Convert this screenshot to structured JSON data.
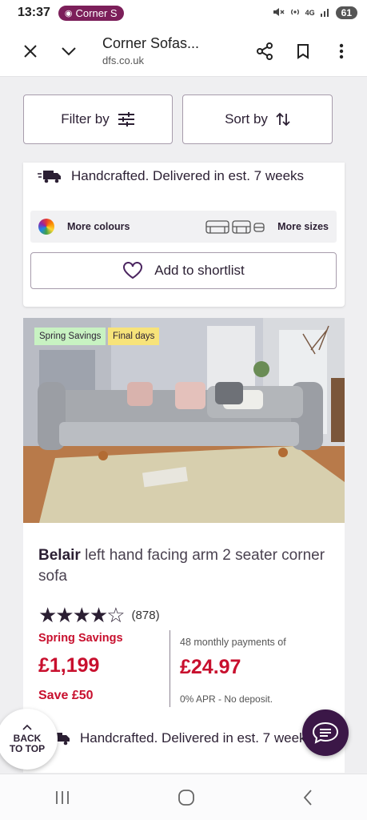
{
  "status_bar": {
    "time": "13:37",
    "notification": "Corner S",
    "network": "4G",
    "battery": "61"
  },
  "browser": {
    "title": "Corner Sofas...",
    "url": "dfs.co.uk"
  },
  "toolbar": {
    "filter_label": "Filter by",
    "sort_label": "Sort by"
  },
  "card_top": {
    "delivery_text": "Handcrafted. Delivered in est. 7 weeks",
    "more_colours": "More colours",
    "more_sizes": "More sizes",
    "shortlist_label": "Add to shortlist"
  },
  "product": {
    "tags": [
      "Spring Savings",
      "Final days"
    ],
    "tag_colors": [
      "#c8f2c2",
      "#f7e37a"
    ],
    "brand": "Belair",
    "title_rest": " left hand facing arm 2 seater corner sofa",
    "rating": 4.5,
    "rating_stars": "★★★★☆",
    "review_count": "(878)",
    "promo_label": "Spring Savings",
    "price": "£1,199",
    "save": "Save £50",
    "monthly_label": "48 monthly payments of",
    "monthly_price": "£24.97",
    "apr_text": "0% APR - No deposit.",
    "delivery_text": "Handcrafted. Delivered in est. 7 weeks"
  },
  "back_to_top": {
    "line1": "BACK",
    "line2": "TO TOP"
  },
  "colors": {
    "brand_purple": "#2b1f33",
    "sale_red": "#c8102e",
    "chat_bg": "#3b1747"
  }
}
